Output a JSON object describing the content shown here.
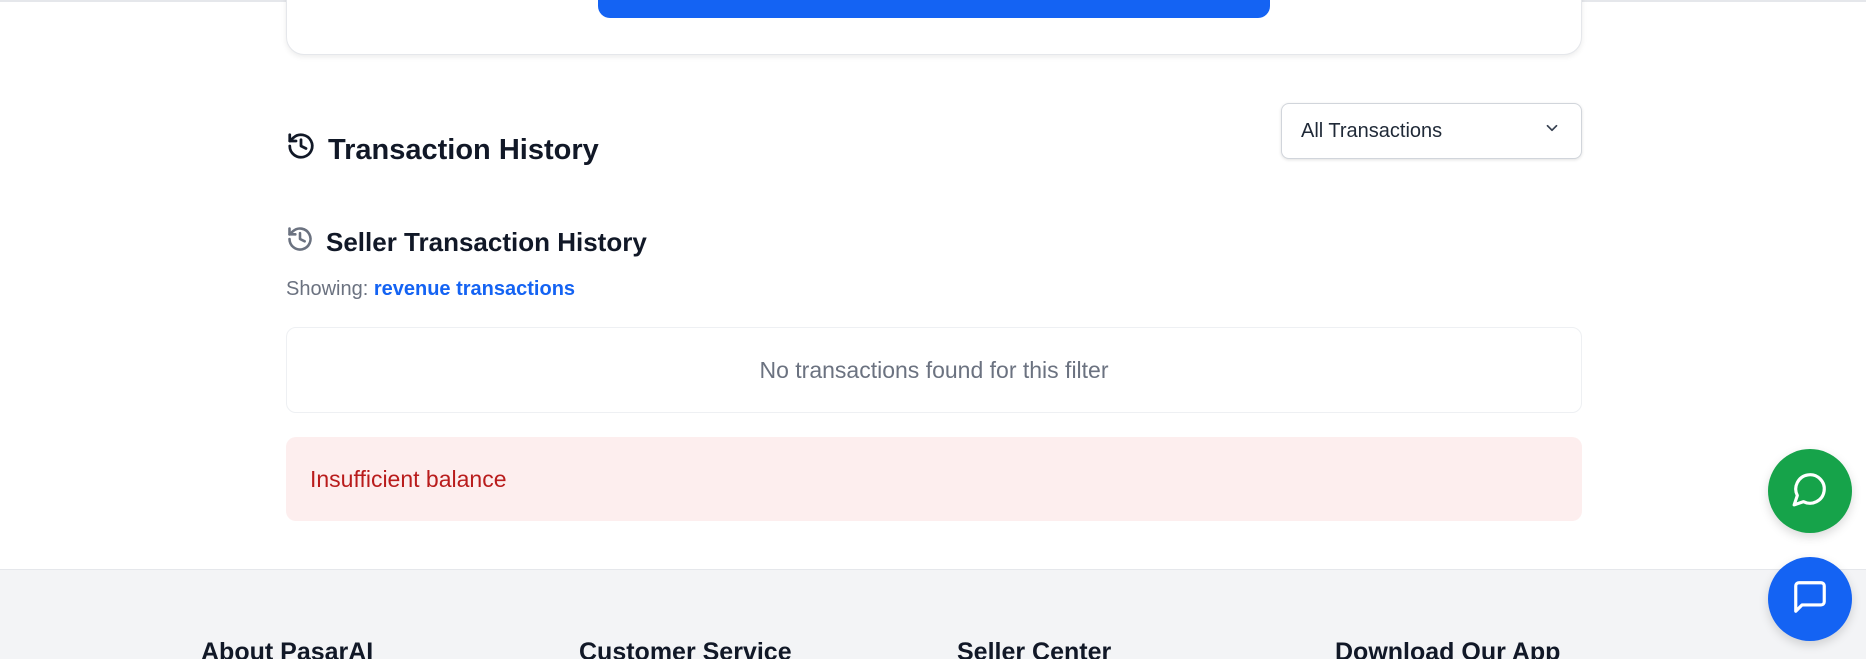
{
  "history": {
    "title": "Transaction History",
    "filter_selected": "All Transactions"
  },
  "seller_history": {
    "title": "Seller Transaction History",
    "showing_label": "Showing:",
    "showing_value": "revenue transactions",
    "empty_message": "No transactions found for this filter",
    "error_message": "Insufficient balance"
  },
  "footer": {
    "columns": [
      "About PasarAI",
      "Customer Service",
      "Seller Center",
      "Download Our App"
    ]
  },
  "icons": {
    "history": "history-icon",
    "dropdown": "chevron-down-icon",
    "whatsapp": "message-circle-icon",
    "chat": "message-square-icon"
  },
  "colors": {
    "accent": "#1463f3",
    "error_text": "#b91c1c",
    "error_bg": "#fdeeee",
    "whatsapp": "#16a34a"
  }
}
